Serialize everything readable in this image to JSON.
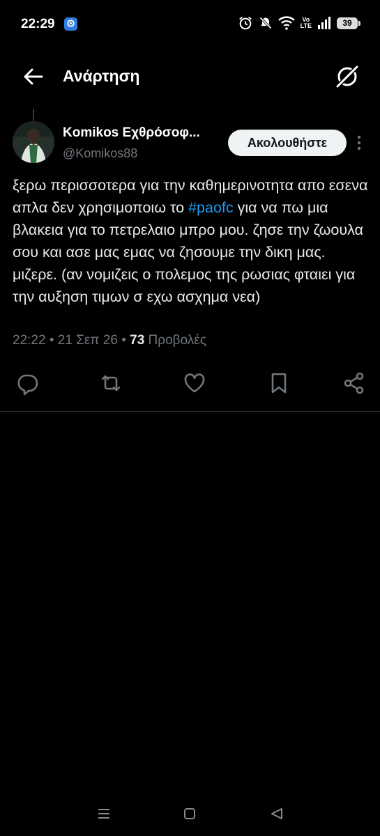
{
  "status_bar": {
    "time": "22:29",
    "network_label_top": "Vo",
    "network_label_bottom": "LTE",
    "battery": "39",
    "icons": [
      "location-shield-icon",
      "alarm-icon",
      "mute-icon",
      "wifi-icon",
      "signal-icon",
      "battery-icon"
    ]
  },
  "header": {
    "title": "Ανάρτηση",
    "back_icon": "arrow-left-icon",
    "grok_icon": "grok-icon"
  },
  "post": {
    "author_name": "Komikos Εχθρόσοφ...",
    "author_handle": "@Komikos88",
    "follow_label": "Ακολουθήστε",
    "text_before": "ξερω περισσοτερα για την καθημερινοτητα απο εσενα απλα δεν χρησιμοποιω το ",
    "hashtag": "#paofc",
    "text_after": " για να πω μια βλακεια για το πετρελαιο μπρο μου. ζησε την ζωουλα σου και ασε μας εμας να ζησουμε την δικη μας. μιζερε. (αν νομιζεις ο πολεμος της ρωσιας φταιει για την αυξηση τιμων σ εχω ασχημα νεα)",
    "time": "22:22",
    "separator": " • ",
    "date": "21 Σεπ 26",
    "views_count": "73",
    "views_label": " Προβολές"
  },
  "actions": [
    "reply-icon",
    "repost-icon",
    "like-icon",
    "bookmark-icon",
    "share-icon"
  ],
  "nav_bar": [
    "menu-icon",
    "home-icon",
    "back-icon"
  ],
  "colors": {
    "background": "#000000",
    "text": "#e7e9ea",
    "secondary": "#71767b",
    "accent": "#1d9bf0",
    "button_bg": "#eff3f4"
  }
}
